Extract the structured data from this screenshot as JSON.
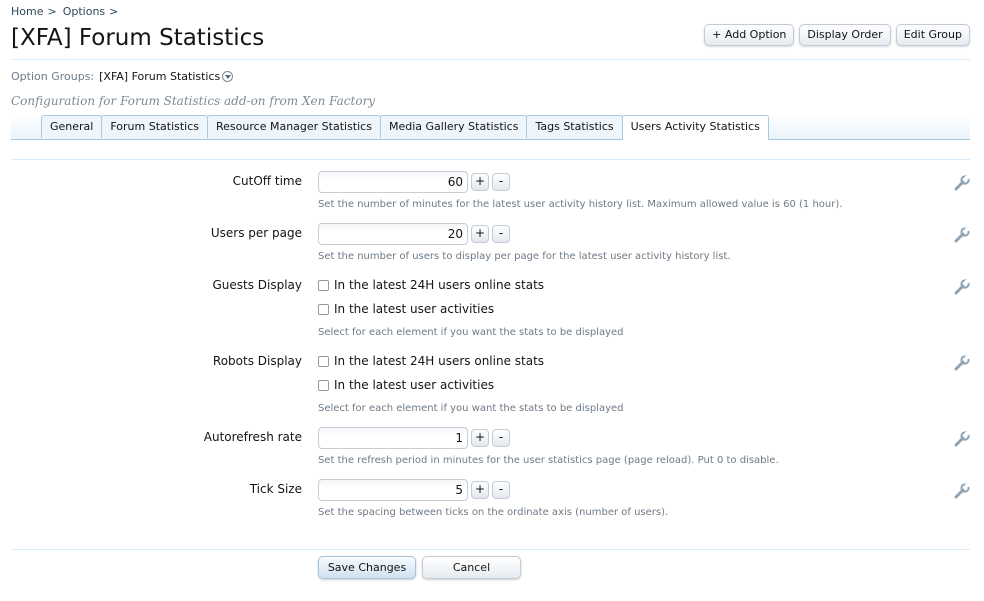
{
  "breadcrumb": {
    "home": "Home",
    "sep1": ">",
    "options": "Options",
    "sep2": ">"
  },
  "page_title": "[XFA] Forum Statistics",
  "top_buttons": {
    "add_option": "+ Add Option",
    "display_order": "Display Order",
    "edit_group": "Edit Group"
  },
  "option_groups": {
    "label": "Option Groups:",
    "value": "[XFA] Forum Statistics"
  },
  "description": "Configuration for Forum Statistics add-on from Xen Factory",
  "tabs": [
    {
      "label": "General"
    },
    {
      "label": "Forum Statistics"
    },
    {
      "label": "Resource Manager Statistics"
    },
    {
      "label": "Media Gallery Statistics"
    },
    {
      "label": "Tags Statistics"
    },
    {
      "label": "Users Activity Statistics",
      "active": true
    }
  ],
  "options": {
    "cutoff": {
      "label": "CutOff time",
      "value": "60",
      "hint": "Set the number of minutes for the latest user activity history list. Maximum allowed value is 60 (1 hour)."
    },
    "per_page": {
      "label": "Users per page",
      "value": "20",
      "hint": "Set the number of users to display per page for the latest user activity history list."
    },
    "guests": {
      "label": "Guests Display",
      "opt1": "In the latest 24H users online stats",
      "opt2": "In the latest user activities",
      "hint": "Select for each element if you want the stats to be displayed"
    },
    "robots": {
      "label": "Robots Display",
      "opt1": "In the latest 24H users online stats",
      "opt2": "In the latest user activities",
      "hint": "Select for each element if you want the stats to be displayed"
    },
    "autorefresh": {
      "label": "Autorefresh rate",
      "value": "1",
      "hint": "Set the refresh period in minutes for the user statistics page (page reload). Put 0 to disable."
    },
    "tick": {
      "label": "Tick Size",
      "value": "5",
      "hint": "Set the spacing between ticks on the ordinate axis (number of users)."
    }
  },
  "spin": {
    "plus": "+",
    "minus": "-"
  },
  "actions": {
    "save": "Save Changes",
    "cancel": "Cancel"
  },
  "icons": {
    "wrench": "wrench-icon",
    "dropdown": "chevron-down-circle-icon"
  }
}
